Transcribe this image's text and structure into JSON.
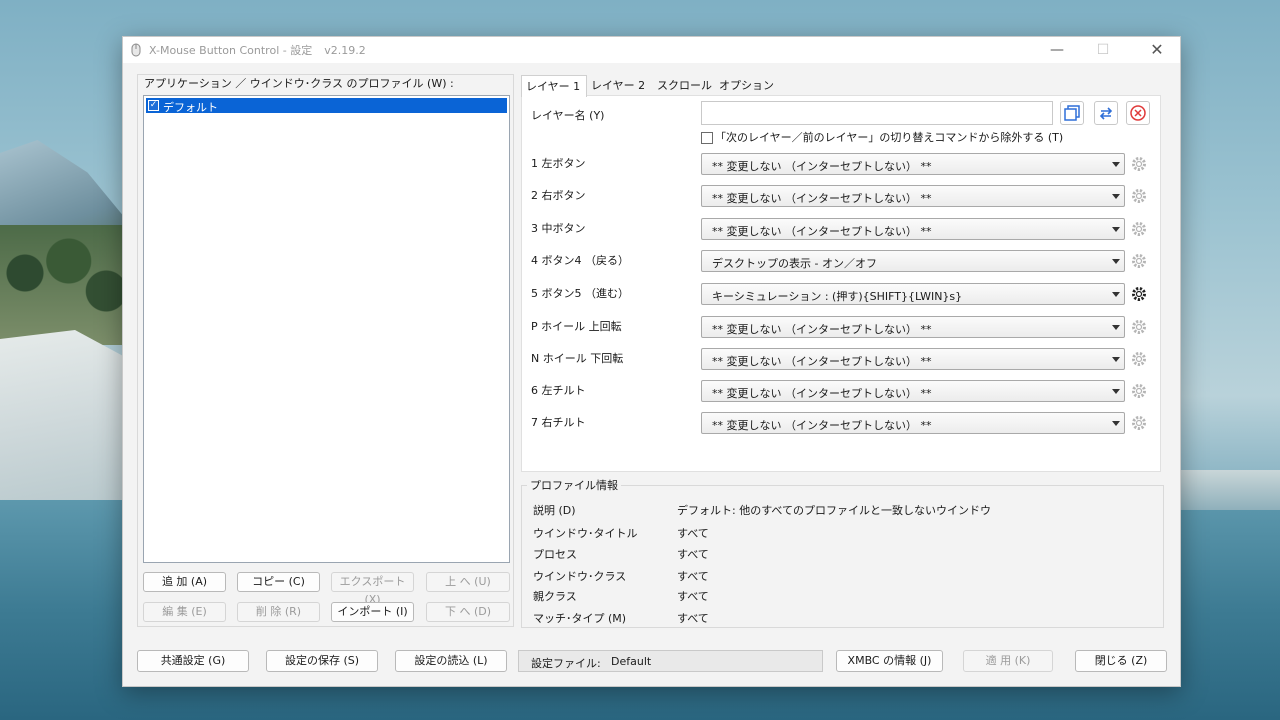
{
  "window": {
    "title": "X-Mouse Button Control - 設定",
    "version": "v2.19.2"
  },
  "left": {
    "profiles_label": "アプリケーション ／ ウインドウ･クラス のプロファイル (W) :",
    "profiles": [
      {
        "name": "デフォルト",
        "checked": true
      }
    ],
    "buttons": {
      "add": "追 加 (A)",
      "copy": "コピー (C)",
      "export": "エクスポート (X)",
      "up": "上 へ (U)",
      "edit": "編 集 (E)",
      "delete": "削 除 (R)",
      "import": "インポート (I)",
      "down": "下 へ (D)"
    }
  },
  "tabs": [
    "レイヤー 1",
    "レイヤー 2",
    "スクロール",
    "オプション"
  ],
  "layer": {
    "name_label": "レイヤー名 (Y)",
    "name_value": "",
    "exclude_label": "「次のレイヤー／前のレイヤー」の切り替えコマンドから除外する (T)",
    "rows": [
      {
        "label": "1  左ボタン",
        "value": "** 変更しない （インターセプトしない） **"
      },
      {
        "label": "2  右ボタン",
        "value": "** 変更しない （インターセプトしない） **"
      },
      {
        "label": "3  中ボタン",
        "value": "** 変更しない （インターセプトしない） **"
      },
      {
        "label": "4  ボタン4 （戻る）",
        "value": "デスクトップの表示  -  オン／オフ"
      },
      {
        "label": "5  ボタン5 （進む）",
        "value": "キーシミュレーション  : (押す){SHIFT}{LWIN}s}"
      },
      {
        "label": "P  ホイール 上回転",
        "value": "** 変更しない （インターセプトしない） **"
      },
      {
        "label": "N  ホイール 下回転",
        "value": "** 変更しない （インターセプトしない） **"
      },
      {
        "label": "6  左チルト",
        "value": "** 変更しない （インターセプトしない） **"
      },
      {
        "label": "7  右チルト",
        "value": "** 変更しない （インターセプトしない） **"
      }
    ]
  },
  "profile_info": {
    "label": "プロファイル情報",
    "rows": [
      {
        "key": "説明 (D)",
        "value": "デフォルト: 他のすべてのプロファイルと一致しないウインドウ"
      },
      {
        "key": "ウインドウ･タイトル",
        "value": "すべて"
      },
      {
        "key": "プロセス",
        "value": "すべて"
      },
      {
        "key": "ウインドウ･クラス",
        "value": "すべて"
      },
      {
        "key": "親クラス",
        "value": "すべて"
      },
      {
        "key": "マッチ･タイプ (M)",
        "value": "すべて"
      }
    ]
  },
  "footer": {
    "common_settings": "共通設定 (G)",
    "save_settings": "設定の保存 (S)",
    "load_settings": "設定の読込 (L)",
    "settings_file_label": "設定ファイル:",
    "settings_file_value": "Default",
    "about": "XMBC の情報 (J)",
    "apply": "適 用 (K)",
    "close": "閉じる (Z)"
  }
}
